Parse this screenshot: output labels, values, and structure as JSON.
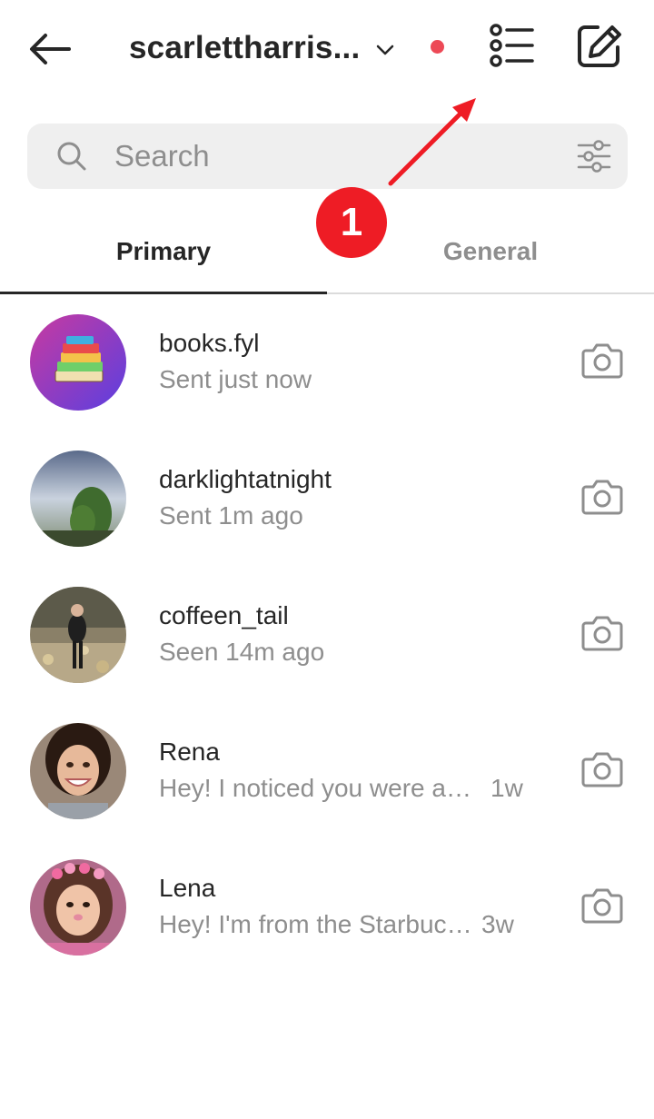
{
  "header": {
    "title": "scarlettharris...",
    "back_icon": "arrow-left-icon",
    "list_icon": "list-icon",
    "compose_icon": "compose-icon",
    "notification_color": "#ed4956"
  },
  "search": {
    "placeholder": "Search"
  },
  "tabs": [
    {
      "label": "Primary",
      "active": true
    },
    {
      "label": "General",
      "active": false
    }
  ],
  "annotation": {
    "number": "1",
    "color": "#ee1c25"
  },
  "threads": [
    {
      "name": "books.fyl",
      "status": "Sent just now",
      "time": ""
    },
    {
      "name": "darklightatnight",
      "status": "Sent 1m ago",
      "time": ""
    },
    {
      "name": "coffeen_tail",
      "status": "Seen 14m ago",
      "time": ""
    },
    {
      "name": "Rena",
      "status": "Hey! I noticed you were a ...",
      "time": "1w"
    },
    {
      "name": "Lena",
      "status": "Hey! I'm from the Starbuck...",
      "time": "3w"
    }
  ]
}
